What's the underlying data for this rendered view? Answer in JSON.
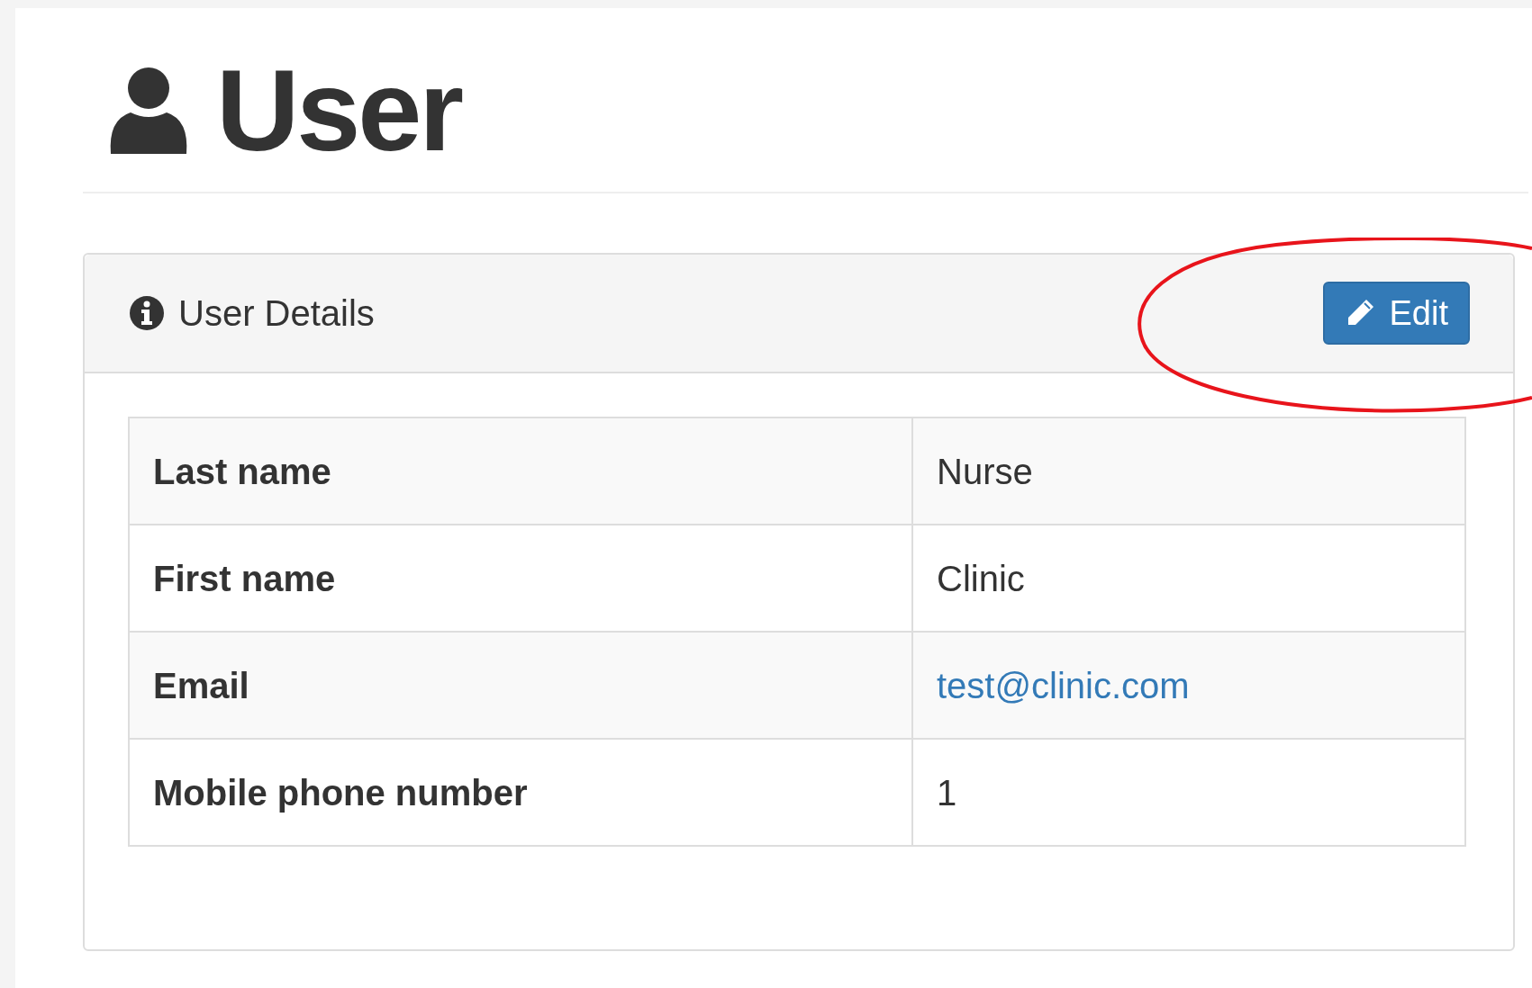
{
  "page": {
    "title": "User"
  },
  "panel": {
    "title": "User Details",
    "edit_button": "Edit"
  },
  "table": {
    "rows": [
      {
        "label": "Last name",
        "value": "Nurse",
        "kind": "text"
      },
      {
        "label": "First name",
        "value": "Clinic",
        "kind": "text"
      },
      {
        "label": "Email",
        "value": "test@clinic.com",
        "kind": "link"
      },
      {
        "label": "Mobile phone number",
        "value": "1",
        "kind": "text"
      }
    ]
  }
}
